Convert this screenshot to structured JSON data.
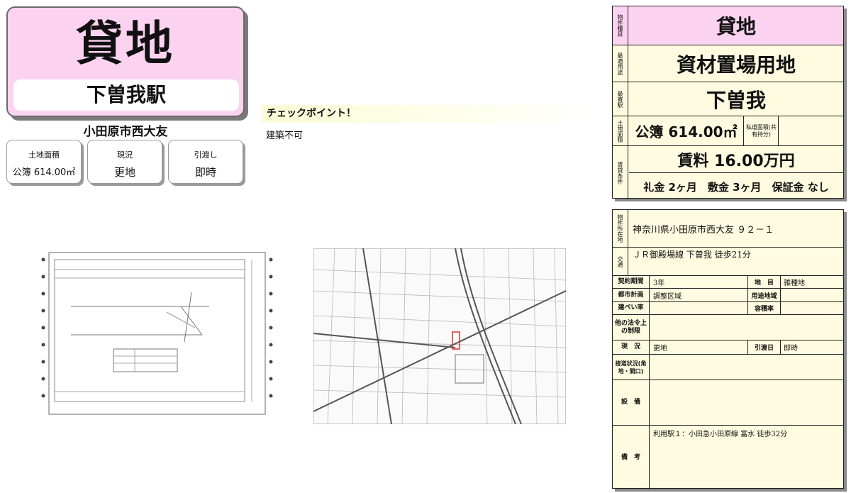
{
  "header": {
    "property_type": "貸地",
    "station": "下曽我駅",
    "city": "小田原市西大友"
  },
  "summary": [
    {
      "label": "土地面積",
      "value": "公簿 614.00㎡"
    },
    {
      "label": "現況",
      "value": "更地"
    },
    {
      "label": "引渡し",
      "value": "即時"
    }
  ],
  "checkpoint": {
    "title": "チェックポイント！",
    "text": "建築不可"
  },
  "panel_top": {
    "type_label": "物件種目",
    "type_value": "貸地",
    "use_label": "最適用途",
    "use_value": "資材置場用地",
    "station_label": "最寄駅",
    "station_value": "下曽我",
    "area_label": "土地面積",
    "area_value": "公簿 614.00㎡",
    "private_road_label": "私道面積(共有持分)",
    "rent_label": "賃貸条件",
    "rent_value": "賃料 16.00万円",
    "fees_value": "礼金 2ヶ月　敷金 3ヶ月　保証金 なし"
  },
  "panel_bottom": {
    "address_label": "物件所在地",
    "address_value": "神奈川県小田原市西大友 ９２－１",
    "transit_label": "交通",
    "transit_value": "ＪＲ御殿場線 下曽我 徒歩21分",
    "rows": {
      "contract_label": "契約期間",
      "contract_value": "3年",
      "land_cat_label": "地　目",
      "land_cat_value": "雑種地",
      "city_plan_label": "都市計画",
      "city_plan_value": "調整区域",
      "zoning_label": "用途地域",
      "zoning_value": "",
      "bcr_label": "建ぺい率",
      "bcr_value": "",
      "far_label": "容積率",
      "far_value": "",
      "law_label": "他の法令上の制限",
      "law_value": "",
      "status_label": "現　況",
      "status_value": "更地",
      "handover_label": "引渡日",
      "handover_value": "即時",
      "road_label": "接道状況(角地・間口)",
      "road_value": "",
      "equipment_label": "設　備",
      "equipment_value": "",
      "remarks_label": "備　考",
      "remarks_value": "利用駅１：小田急小田原線 富水 徒歩32分"
    }
  }
}
